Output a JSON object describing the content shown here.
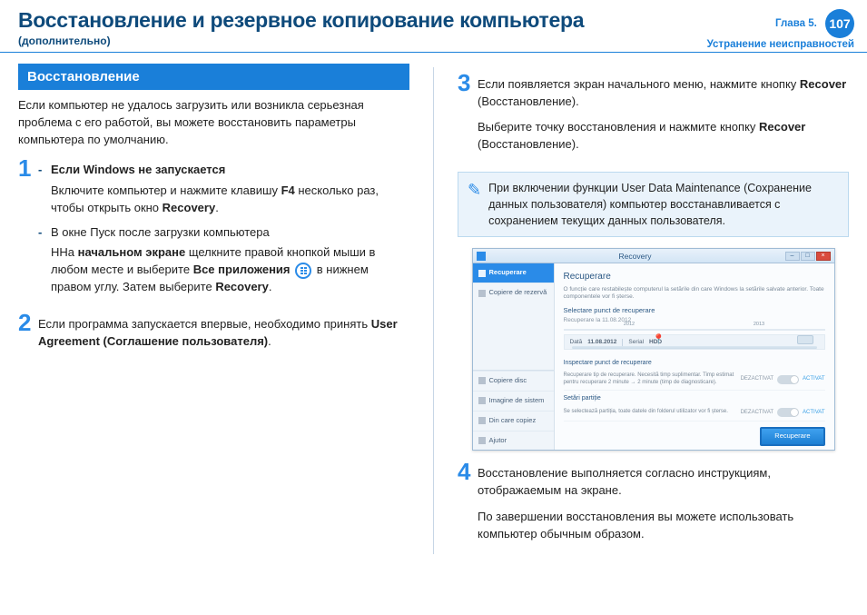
{
  "header": {
    "title": "Восстановление и резервное копирование компьютера",
    "subtitle": "(дополнительно)",
    "chapter_line1": "Глава 5.",
    "chapter_line2": "Устранение неисправностей",
    "page_number": "107"
  },
  "left": {
    "section_title": "Восстановление",
    "intro": "Если компьютер не удалось загрузить или возникла серьезная проблема с его работой, вы можете восстановить параметры компьютера по умолчанию.",
    "step1": {
      "num": "1",
      "dash1_title": "Если Windows не запускается",
      "dash1_body_a": "Включите компьютер и нажмите клавишу ",
      "dash1_key": "F4",
      "dash1_body_b": " несколько раз, чтобы открыть окно ",
      "dash1_recovery": "Recovery",
      "dash1_period": ".",
      "dash2_title": "В окне Пуск после загрузки компьютера",
      "dash2_a": "ННа ",
      "dash2_b_bold": "начальном экране",
      "dash2_c": " щелкните правой кнопкой мыши в любом месте и выберите ",
      "dash2_d_bold": "Все приложения",
      "dash2_e": " в нижнем правом углу. Затем выберите ",
      "dash2_f_bold": "Recovery",
      "dash2_g": "."
    },
    "step2": {
      "num": "2",
      "a": "Если программа запускается впервые, необходимо принять ",
      "b_bold": "User Agreement (Соглашение пользователя)",
      "c": "."
    }
  },
  "right": {
    "step3": {
      "num": "3",
      "a": "Если появляется экран начального меню, нажмите кнопку ",
      "b_bold": "Recover",
      "c": " (Восстановление).",
      "d": "Выберите точку восстановления и нажмите кнопку ",
      "e_bold": "Recover",
      "f": " (Восстановление)."
    },
    "infobox": "При включении функции User Data Maintenance (Сохранение данных пользователя) компьютер восстанавливается с сохранением текущих данных пользователя.",
    "app": {
      "titlebar": "Recovery",
      "sidebar": {
        "active": "Recuperare",
        "item1": "Copiere de rezervă",
        "bottom1": "Copiere disc",
        "bottom2": "Imagine de sistem",
        "bottom3": "Din care copiez",
        "bottom4": "Ajutor"
      },
      "main": {
        "heading": "Recuperare",
        "desc": "O funcție care restabilește computerul la setările din care Windows la setările salvate anterior. Toate componentele vor fi șterse.",
        "sec_title": "Selectare punct de recuperare",
        "sec_sub": "Recuperare la 11.08.2012",
        "tl_year_a": "2012",
        "tl_year_b": "2013",
        "info_date_lbl": "Dată",
        "info_date_val": "11.08.2012",
        "info_ser_lbl": "Serial",
        "info_ser_val": "HDD",
        "opt1_head": "Inspectare punct de recuperare",
        "opt1_sub": "Recuperare tip de recuperare. Necesită timp suplimentar. Timp estimat pentru recuperare 2 minute → 2 minute (timp de diagnosticare).",
        "opt2_head": "Setări partiție",
        "opt2_sub": "Se selectează partiția, toate datele din folderul utilizator vor fi șterse.",
        "state_off": "DEZACTIVAT",
        "state_on": "ACTIVAT",
        "primary": "Recuperare"
      }
    },
    "step4": {
      "num": "4",
      "a": "Восстановление выполняется согласно инструкциям, отображаемым на экране.",
      "b": "По завершении восстановления вы можете использовать компьютер обычным образом."
    }
  }
}
